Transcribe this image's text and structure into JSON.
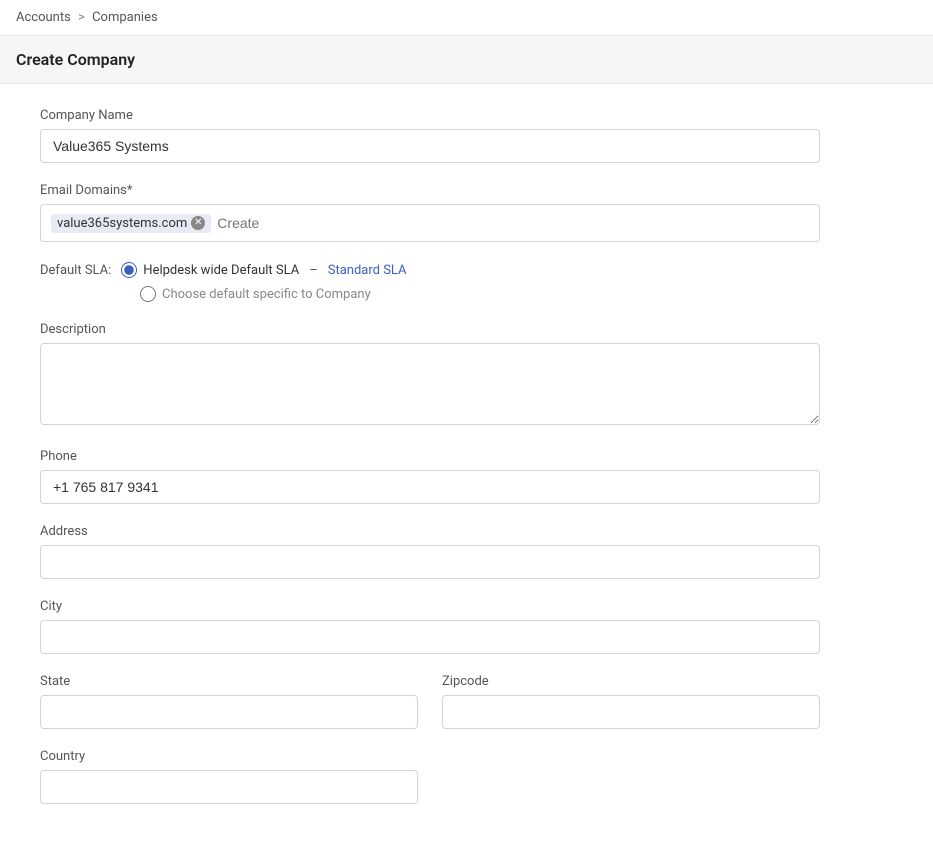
{
  "breadcrumb": {
    "accounts": "Accounts",
    "separator": ">",
    "companies": "Companies"
  },
  "page_header": {
    "title": "Create Company"
  },
  "form": {
    "company_name_label": "Company Name",
    "company_name_value": "Value365 Systems",
    "company_name_placeholder": "",
    "email_domains_label": "Email Domains*",
    "email_domain_tag": "value365systems.com",
    "email_domains_create_placeholder": "Create",
    "default_sla_label": "Default SLA:",
    "default_sla_option1_label": "Helpdesk wide Default SLA",
    "default_sla_dash": "–",
    "default_sla_link": "Standard SLA",
    "default_sla_option2_label": "Choose default specific to Company",
    "description_label": "Description",
    "description_value": "",
    "description_placeholder": "",
    "phone_label": "Phone",
    "phone_value": "+1 765 817 9341",
    "phone_placeholder": "",
    "address_label": "Address",
    "address_value": "",
    "address_placeholder": "",
    "city_label": "City",
    "city_value": "",
    "city_placeholder": "",
    "state_label": "State",
    "state_value": "",
    "state_placeholder": "",
    "zipcode_label": "Zipcode",
    "zipcode_value": "",
    "zipcode_placeholder": "",
    "country_label": "Country",
    "country_value": "",
    "country_placeholder": ""
  }
}
